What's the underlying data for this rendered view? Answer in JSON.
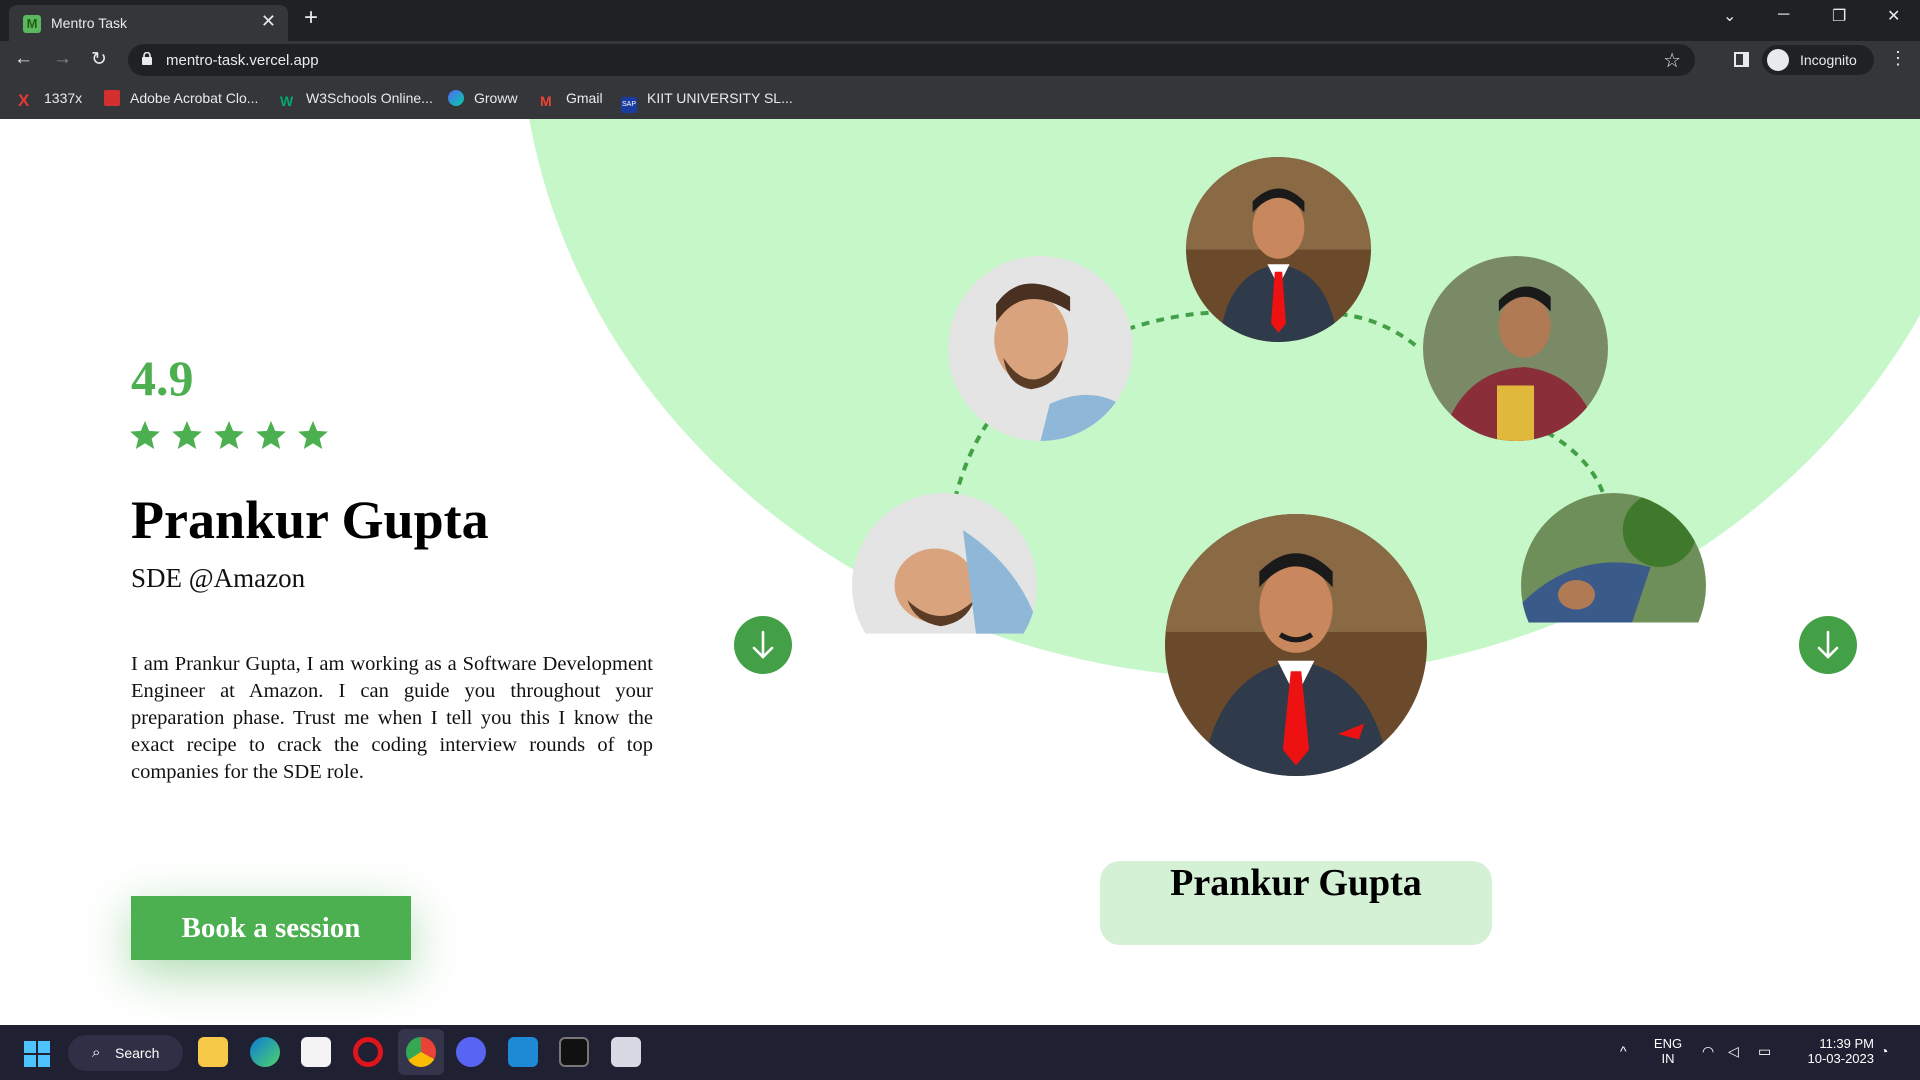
{
  "browser": {
    "tab_title": "Mentro Task",
    "tab_favicon_letter": "M",
    "url": "mentro-task.vercel.app",
    "profile_label": "Incognito",
    "bookmarks": [
      "1337x",
      "Adobe Acrobat Clo...",
      "W3Schools Online...",
      "Groww",
      "Gmail",
      "KIIT UNIVERSITY SL..."
    ]
  },
  "mentor": {
    "rating": "4.9",
    "stars": 5,
    "name": "Prankur Gupta",
    "role": "SDE @Amazon",
    "bio": "I am Prankur Gupta, I am working as a Software Development Engineer at Amazon. I can guide you throughout your preparation phase. Trust me when I tell you this I know the exact recipe to crack the coding interview rounds of top companies for the SDE role.",
    "cta_label": "Book a session",
    "featured_name": "Prankur Gupta"
  },
  "colors": {
    "accent": "#4caf50",
    "background_blob": "#c5f7c8",
    "name_card": "#d4f0d5"
  },
  "taskbar": {
    "search_label": "Search",
    "language": "ENG",
    "region": "IN",
    "time": "11:39 PM",
    "date": "10-03-2023"
  }
}
